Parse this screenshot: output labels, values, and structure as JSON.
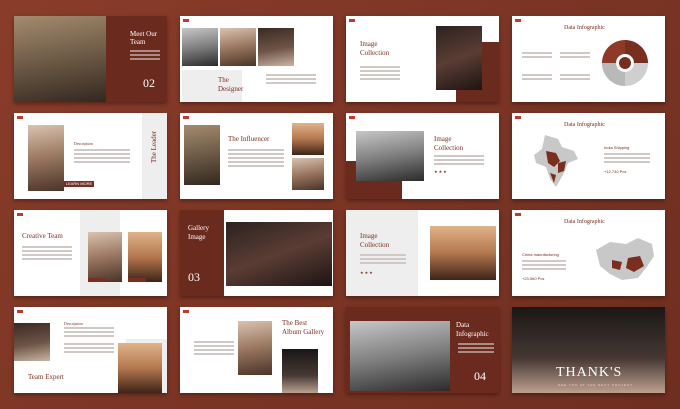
{
  "slides": {
    "s1": {
      "title": "Meet Our Team",
      "number": "02"
    },
    "s2": {
      "title": "The Designer"
    },
    "s3": {
      "title": "Image Collection"
    },
    "s4": {
      "title": "Data Infographic"
    },
    "s5": {
      "title": "The Leader",
      "subhead": "Description",
      "button": "LEARN MORE"
    },
    "s6": {
      "title": "The Influencer"
    },
    "s7": {
      "title": "Image Collection",
      "stars": "★★★"
    },
    "s8": {
      "title": "Data Infographic",
      "label": "India Shipping",
      "value": "+12.740 Pcs"
    },
    "s9": {
      "title": "Creative Team"
    },
    "s10": {
      "title": "Gallery Image",
      "number": "03"
    },
    "s11": {
      "title": "Image Collection",
      "stars": "★★★"
    },
    "s12": {
      "title": "Data Infographic",
      "label": "China manufacturing",
      "value": "+23.560 Pcs"
    },
    "s13": {
      "title": "Team Expert",
      "subhead": "Description"
    },
    "s14": {
      "title": "The Best Album Gallery"
    },
    "s15": {
      "title": "Data Infographic",
      "number": "04"
    },
    "s16": {
      "title": "THANK'S",
      "subtitle": "SEE YOU AT THE NEXT PROJECT"
    }
  },
  "colors": {
    "accent": "#7a2e1f",
    "background": "#7a3424",
    "slide_bg": "#ffffff"
  },
  "icons": {
    "logo": "brand-logo-icon",
    "pie": "pie-chart-icon",
    "map_india": "india-map-icon",
    "map_china": "china-map-icon"
  }
}
